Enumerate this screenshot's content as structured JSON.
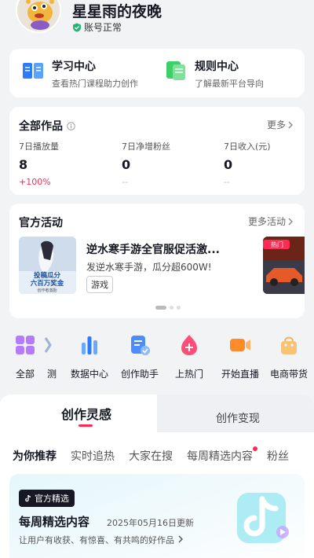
{
  "profile": {
    "name": "星星雨的夜晚",
    "status": "账号正常"
  },
  "centers": [
    {
      "title": "学习中心",
      "subtitle": "查看热门课程助力创作",
      "icon": "book-icon"
    },
    {
      "title": "规则中心",
      "subtitle": "了解最新平台导向",
      "icon": "rules-icon"
    }
  ],
  "works": {
    "title": "全部作品",
    "more": "更多",
    "stats": [
      {
        "label": "7日播放量",
        "value": "8",
        "change": "+100%"
      },
      {
        "label": "7日净增粉丝",
        "value": "0",
        "change": "--"
      },
      {
        "label": "7日收入(元)",
        "value": "0",
        "change": "--"
      }
    ]
  },
  "activities": {
    "title": "官方活动",
    "more": "更多活动",
    "item": {
      "title": "逆水寒手游全官服促活激...",
      "desc": "发逆水寒手游，瓜分超600W!",
      "tag": "游戏",
      "poster_text": [
        "投稿瓜分",
        "六百万奖金",
        "创作者激励"
      ]
    },
    "next_item": {
      "tag": "热门"
    }
  },
  "tools": [
    {
      "label": "全部",
      "icon": "grid-icon"
    },
    {
      "label": "测",
      "icon": "partial-icon"
    },
    {
      "label": "数据中心",
      "icon": "chart-icon"
    },
    {
      "label": "创作助手",
      "icon": "assistant-icon"
    },
    {
      "label": "上热门",
      "icon": "hot-icon"
    },
    {
      "label": "开始直播",
      "icon": "live-icon"
    },
    {
      "label": "电商带货",
      "icon": "shopping-bag-icon"
    }
  ],
  "main_tabs": {
    "active": "创作灵感",
    "other": "创作变现"
  },
  "sub_tabs": [
    "为你推荐",
    "实时追热",
    "大家在搜",
    "每周精选内容",
    "粉丝"
  ],
  "weekly": {
    "badge": "官方精选",
    "title": "每周精选内容",
    "date": "2025年05月16日更新",
    "desc": "让用户有收获、有惊喜、有共鸣的好作品"
  },
  "colors": {
    "accent": "#fe2c55",
    "text": "#161823",
    "background": "#f2f3f5"
  }
}
